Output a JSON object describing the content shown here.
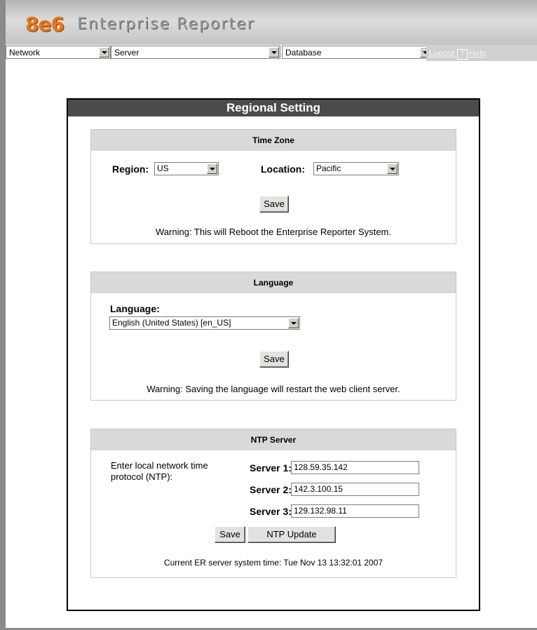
{
  "header": {
    "logo_mark": "8e6",
    "app_title": "Enterprise Reporter"
  },
  "menubar": {
    "network": "Network",
    "server": "Server",
    "database": "Database",
    "logout": "Logout",
    "help_icon": "?",
    "help": "Help"
  },
  "panel": {
    "title": "Regional Setting"
  },
  "timezone": {
    "heading": "Time Zone",
    "region_label": "Region:",
    "region_value": "US",
    "location_label": "Location:",
    "location_value": "Pacific",
    "save": "Save",
    "warning": "Warning: This will Reboot the Enterprise Reporter System."
  },
  "language": {
    "heading": "Language",
    "label": "Language:",
    "value": "English (United States) [en_US]",
    "save": "Save",
    "warning": "Warning: Saving the language will restart the web client server."
  },
  "ntp": {
    "heading": "NTP Server",
    "description_line1": "Enter local network time",
    "description_line2": "protocol (NTP):",
    "server1_label": "Server 1:",
    "server1_value": "128.59.35.142",
    "server2_label": "Server 2:",
    "server2_value": "142.3.100.15",
    "server3_label": "Server 3:",
    "server3_value": "129.132.98.11",
    "save": "Save",
    "update": "NTP Update",
    "system_time": "Current ER server system time: Tue Nov 13 13:32:01 2007"
  },
  "colors": {
    "logo_accent": "#e4761c",
    "panel_header": "#4b4b4b",
    "section_header": "#d9d9d9"
  }
}
